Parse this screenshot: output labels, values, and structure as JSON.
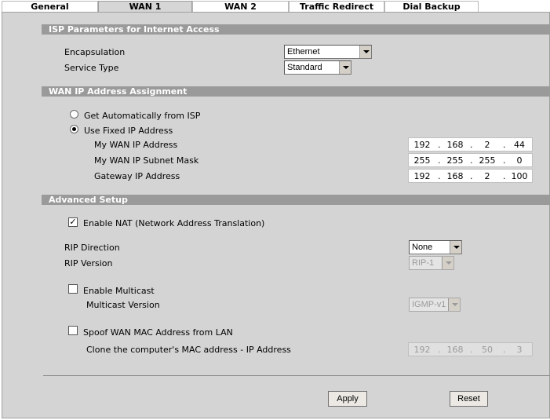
{
  "tabs": [
    {
      "label": "General"
    },
    {
      "label": "WAN 1"
    },
    {
      "label": "WAN 2"
    },
    {
      "label": "Traffic Redirect"
    },
    {
      "label": "Dial Backup"
    }
  ],
  "isp_section": {
    "title": "ISP Parameters for Internet Access",
    "encapsulation_label": "Encapsulation",
    "encapsulation_value": "Ethernet",
    "service_type_label": "Service Type",
    "service_type_value": "Standard"
  },
  "wan_ip_section": {
    "title": "WAN IP Address Assignment",
    "auto_label": "Get Automatically from ISP",
    "fixed_label": "Use Fixed IP Address",
    "wan_ip_label": "My WAN IP Address",
    "wan_ip": [
      "192",
      "168",
      "2",
      "44"
    ],
    "subnet_label": "My WAN IP Subnet Mask",
    "subnet": [
      "255",
      "255",
      "255",
      "0"
    ],
    "gateway_label": "Gateway IP Address",
    "gateway": [
      "192",
      "168",
      "2",
      "100"
    ],
    "dot": "."
  },
  "advanced_section": {
    "title": "Advanced Setup",
    "nat_label": "Enable NAT (Network Address Translation)",
    "nat_check": "✓",
    "rip_direction_label": "RIP Direction",
    "rip_direction_value": "None",
    "rip_version_label": "RIP Version",
    "rip_version_value": "RIP-1",
    "multicast_label": "Enable Multicast",
    "multicast_version_label": "Multicast Version",
    "multicast_version_value": "IGMP-v1",
    "spoof_label": "Spoof WAN MAC Address from LAN",
    "clone_label": "Clone the computer's MAC address - IP Address",
    "clone_ip": [
      "192",
      "168",
      "50",
      "3"
    ]
  },
  "buttons": {
    "apply": "Apply",
    "reset": "Reset"
  }
}
